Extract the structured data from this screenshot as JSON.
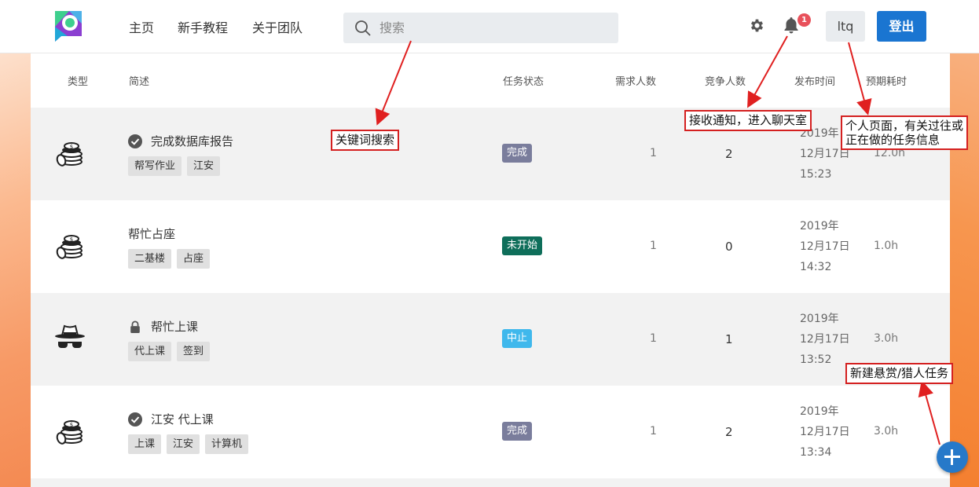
{
  "nav": {
    "links": [
      "主页",
      "新手教程",
      "关于团队"
    ],
    "search_placeholder": "搜索",
    "notification_count": "1",
    "user": "ltq",
    "logout": "登出"
  },
  "table": {
    "headers": [
      "类型",
      "简述",
      "任务状态",
      "需求人数",
      "竞争人数",
      "发布时间",
      "预期耗时"
    ],
    "rows": [
      {
        "type_icon": "coins-icon",
        "title_icon": "check-circle-icon",
        "title": "完成数据库报告",
        "tags": [
          "帮写作业",
          "江安"
        ],
        "status": "完成",
        "status_color": "#7a7d9c",
        "need": "1",
        "competitors": "2",
        "time": [
          "2019年",
          "12月17日",
          "15:23"
        ],
        "hours": "12.0h"
      },
      {
        "type_icon": "coins-icon",
        "title_icon": "",
        "title": "帮忙占座",
        "tags": [
          "二基楼",
          "占座"
        ],
        "status": "未开始",
        "status_color": "#0e6e5a",
        "need": "1",
        "competitors": "0",
        "time": [
          "2019年",
          "12月17日",
          "14:32"
        ],
        "hours": "1.0h"
      },
      {
        "type_icon": "spy-icon",
        "title_icon": "lock-icon",
        "title": "帮忙上课",
        "tags": [
          "代上课",
          "签到"
        ],
        "status": "中止",
        "status_color": "#3fb8ec",
        "need": "1",
        "competitors": "1",
        "time": [
          "2019年",
          "12月17日",
          "13:52"
        ],
        "hours": "3.0h"
      },
      {
        "type_icon": "coins-icon",
        "title_icon": "check-circle-icon",
        "title": "江安 代上课",
        "tags": [
          "上课",
          "江安",
          "计算机"
        ],
        "status": "完成",
        "status_color": "#7a7d9c",
        "need": "1",
        "competitors": "2",
        "time": [
          "2019年",
          "12月17日",
          "13:34"
        ],
        "hours": "3.0h"
      }
    ]
  },
  "annotations": {
    "search": "关键词搜索",
    "notify": "接收通知，进入聊天室",
    "profile_line1": "个人页面，有关过往或",
    "profile_line2": "正在做的任务信息",
    "new_task": "新建悬赏/猎人任务"
  },
  "colors": {
    "accent": "#1a75d1",
    "fab": "#2779c9",
    "badge": "#e8515b",
    "annotation": "#d42020"
  }
}
